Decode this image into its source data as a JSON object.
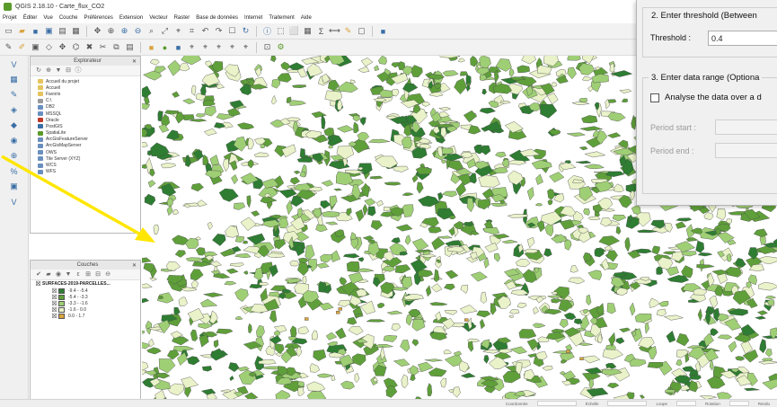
{
  "window": {
    "title": "QGIS 2.18.10 - Carte_flux_CO2"
  },
  "menu": {
    "items": [
      "Projet",
      "Éditer",
      "Vue",
      "Couche",
      "Préférences",
      "Extension",
      "Vecteur",
      "Raster",
      "Base de données",
      "Internet",
      "Traitement",
      "Aide"
    ]
  },
  "browser_panel": {
    "title": "Explorateur",
    "items": [
      "Accueil du projet",
      "Accueil",
      "Favoris",
      "C:\\",
      "DB2",
      "MSSQL",
      "Oracle",
      "PostGIS",
      "SpatiaLite",
      "ArcGisFeatureServer",
      "ArcGisMapServer",
      "OWS",
      "Tile Server (XYZ)",
      "WCS",
      "WFS"
    ]
  },
  "layers_panel": {
    "title": "Couches",
    "layer_name": "SURFACES-2019-PARCELLES...",
    "legend": [
      {
        "label": "-9.4 - -5.4",
        "color": "#2e7d32"
      },
      {
        "label": "-5.4 - -3.3",
        "color": "#5f9f3a"
      },
      {
        "label": "-3.3 - -1.6",
        "color": "#9fcf75"
      },
      {
        "label": "-1.6 - 0.0",
        "color": "#e9f2c9"
      },
      {
        "label": "0.0 - 1.7",
        "color": "#d9a441"
      }
    ]
  },
  "dialog": {
    "group2_title": "2. Enter threshold (Between",
    "threshold_label": "Threshold :",
    "threshold_value": "0.4",
    "group3_title": "3. Enter data range (Optiona",
    "analyse_label": "Analyse the data over a d",
    "period_start_label": "Period start :",
    "period_end_label": "Period end :"
  },
  "statusbar": {
    "coordinate_label": "Coordonnée",
    "scale_label": "Échelle",
    "magnifier_label": "Loupe",
    "rotation_label": "Rotation",
    "render_label": "Rendu"
  },
  "colors": {
    "annotation_arrow": "#ffe600",
    "dark_green": "#2e7d32",
    "mid_green": "#5f9f3a",
    "light_green": "#9fcf75",
    "pale": "#e9f2c9"
  }
}
